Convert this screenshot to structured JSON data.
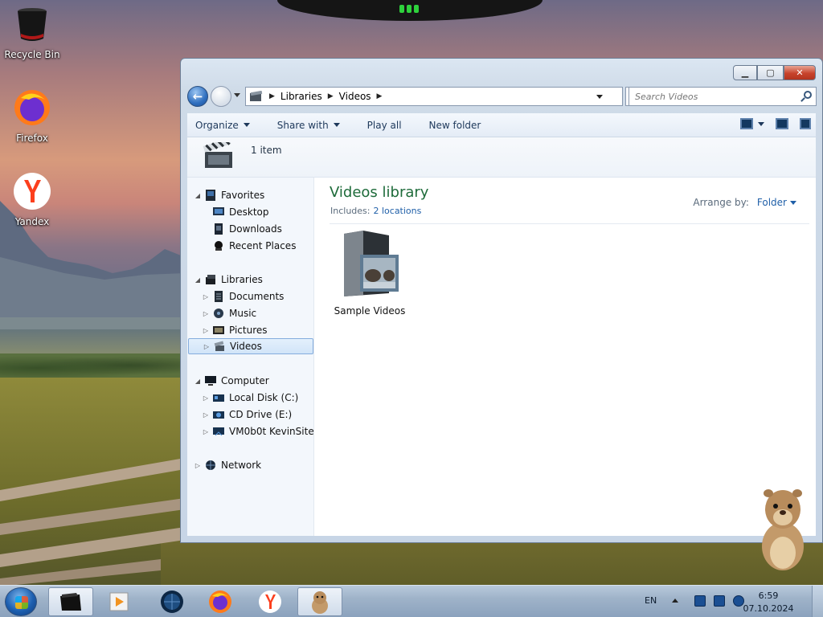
{
  "desktop": {
    "icons": [
      {
        "label": "Recycle Bin"
      },
      {
        "label": "Firefox"
      },
      {
        "label": "Yandex"
      }
    ]
  },
  "window": {
    "address": {
      "crumbs": [
        "Libraries",
        "Videos"
      ]
    },
    "search": {
      "placeholder": "Search Videos"
    },
    "commands": {
      "organize": "Organize",
      "share_with": "Share with",
      "play_all": "Play all",
      "new_folder": "New folder"
    },
    "details": {
      "count": "1 item"
    },
    "nav": {
      "favorites": "Favorites",
      "desktop": "Desktop",
      "downloads": "Downloads",
      "recent": "Recent Places",
      "libraries": "Libraries",
      "documents": "Documents",
      "music": "Music",
      "pictures": "Pictures",
      "videos": "Videos",
      "computer": "Computer",
      "local_disk": "Local Disk (C:)",
      "cd_drive": "CD Drive (E:)",
      "site": "VM0b0t KevinSite",
      "network": "Network"
    },
    "library": {
      "title": "Videos library",
      "includes_label": "Includes:",
      "includes_link": "2 locations",
      "arrange_label": "Arrange by:",
      "arrange_value": "Folder"
    },
    "items": [
      {
        "label": "Sample Videos"
      }
    ]
  },
  "taskbar": {
    "lang": "EN",
    "time": "6:59",
    "date": "07.10.2024"
  }
}
